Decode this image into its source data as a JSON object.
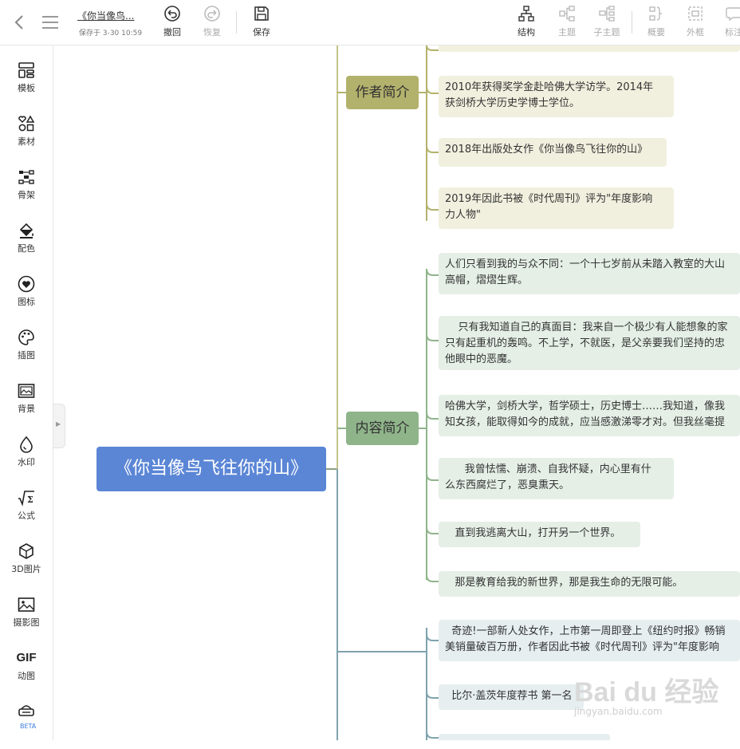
{
  "header": {
    "document_title": "《你当像鸟...",
    "saved_status": "保存于 3-30 10:59",
    "undo_label": "撤回",
    "redo_label": "恢复",
    "save_label": "保存",
    "structure_label": "结构",
    "topic_label": "主题",
    "subtopic_label": "子主题",
    "summary_label": "概要",
    "boundary_label": "外框",
    "callout_label": "标注"
  },
  "sidebar": {
    "items": [
      {
        "label": "模板",
        "icon": "template-icon"
      },
      {
        "label": "素材",
        "icon": "shapes-icon"
      },
      {
        "label": "骨架",
        "icon": "skeleton-icon"
      },
      {
        "label": "配色",
        "icon": "paint-bucket-icon"
      },
      {
        "label": "图标",
        "icon": "heart-icon"
      },
      {
        "label": "插图",
        "icon": "palette-icon"
      },
      {
        "label": "背景",
        "icon": "background-icon"
      },
      {
        "label": "水印",
        "icon": "drop-icon"
      },
      {
        "label": "公式",
        "icon": "formula-icon"
      },
      {
        "label": "3D图片",
        "icon": "cube-icon"
      },
      {
        "label": "摄影图",
        "icon": "photo-icon"
      },
      {
        "label": "动图",
        "icon": "gif-icon",
        "glyph": "GIF"
      },
      {
        "label": "",
        "icon": "ai-icon"
      }
    ],
    "beta_badge": "BETA"
  },
  "mindmap": {
    "root": "《你当像鸟飞往你的山》",
    "branches": [
      {
        "label": "作者简介",
        "color": "#b3b26d",
        "children": [
          "2010年获得奖学金赴哈佛大学访学。2014年\n获剑桥大学历史学博士学位。",
          "2018年出版处女作《你当像鸟飞往你的山》",
          "2019年因此书被《时代周刊》评为\"年度影响\n力人物\""
        ]
      },
      {
        "label": "内容简介",
        "color": "#8fb48a",
        "children": [
          "人们只看到我的与众不同：一个十七岁前从未踏入教室的大山\n高帽，熠熠生辉。",
          "    只有我知道自己的真面目：我来自一个极少有人能想象的家\n只有起重机的轰鸣。不上学，不就医，是父亲要我们坚持的忠\n他眼中的恶魔。",
          "哈佛大学，剑桥大学，哲学硕士，历史博士……我知道，像我\n知女孩，能取得如今的成就，应当感激涕零才对。但我丝毫提",
          "      我曾怯懦、崩溃、自我怀疑，内心里有什\n么东西腐烂了，恶臭熏天。",
          "   直到我逃离大山，打开另一个世界。",
          "   那是教育给我的新世界，那是我生命的无限可能。"
        ]
      },
      {
        "label": "",
        "color": "#7ea3ad",
        "children": [
          "  奇迹!一部新人处女作，上市第一周即登上《纽约时报》畅销\n美销量破百万册，作者因此书被《时代周刊》评为\"年度影响",
          "  比尔·盖茨年度荐书 第一名"
        ]
      }
    ]
  },
  "watermark": {
    "brand": "Bai du 经验",
    "url": "jingyan.baidu.com"
  }
}
